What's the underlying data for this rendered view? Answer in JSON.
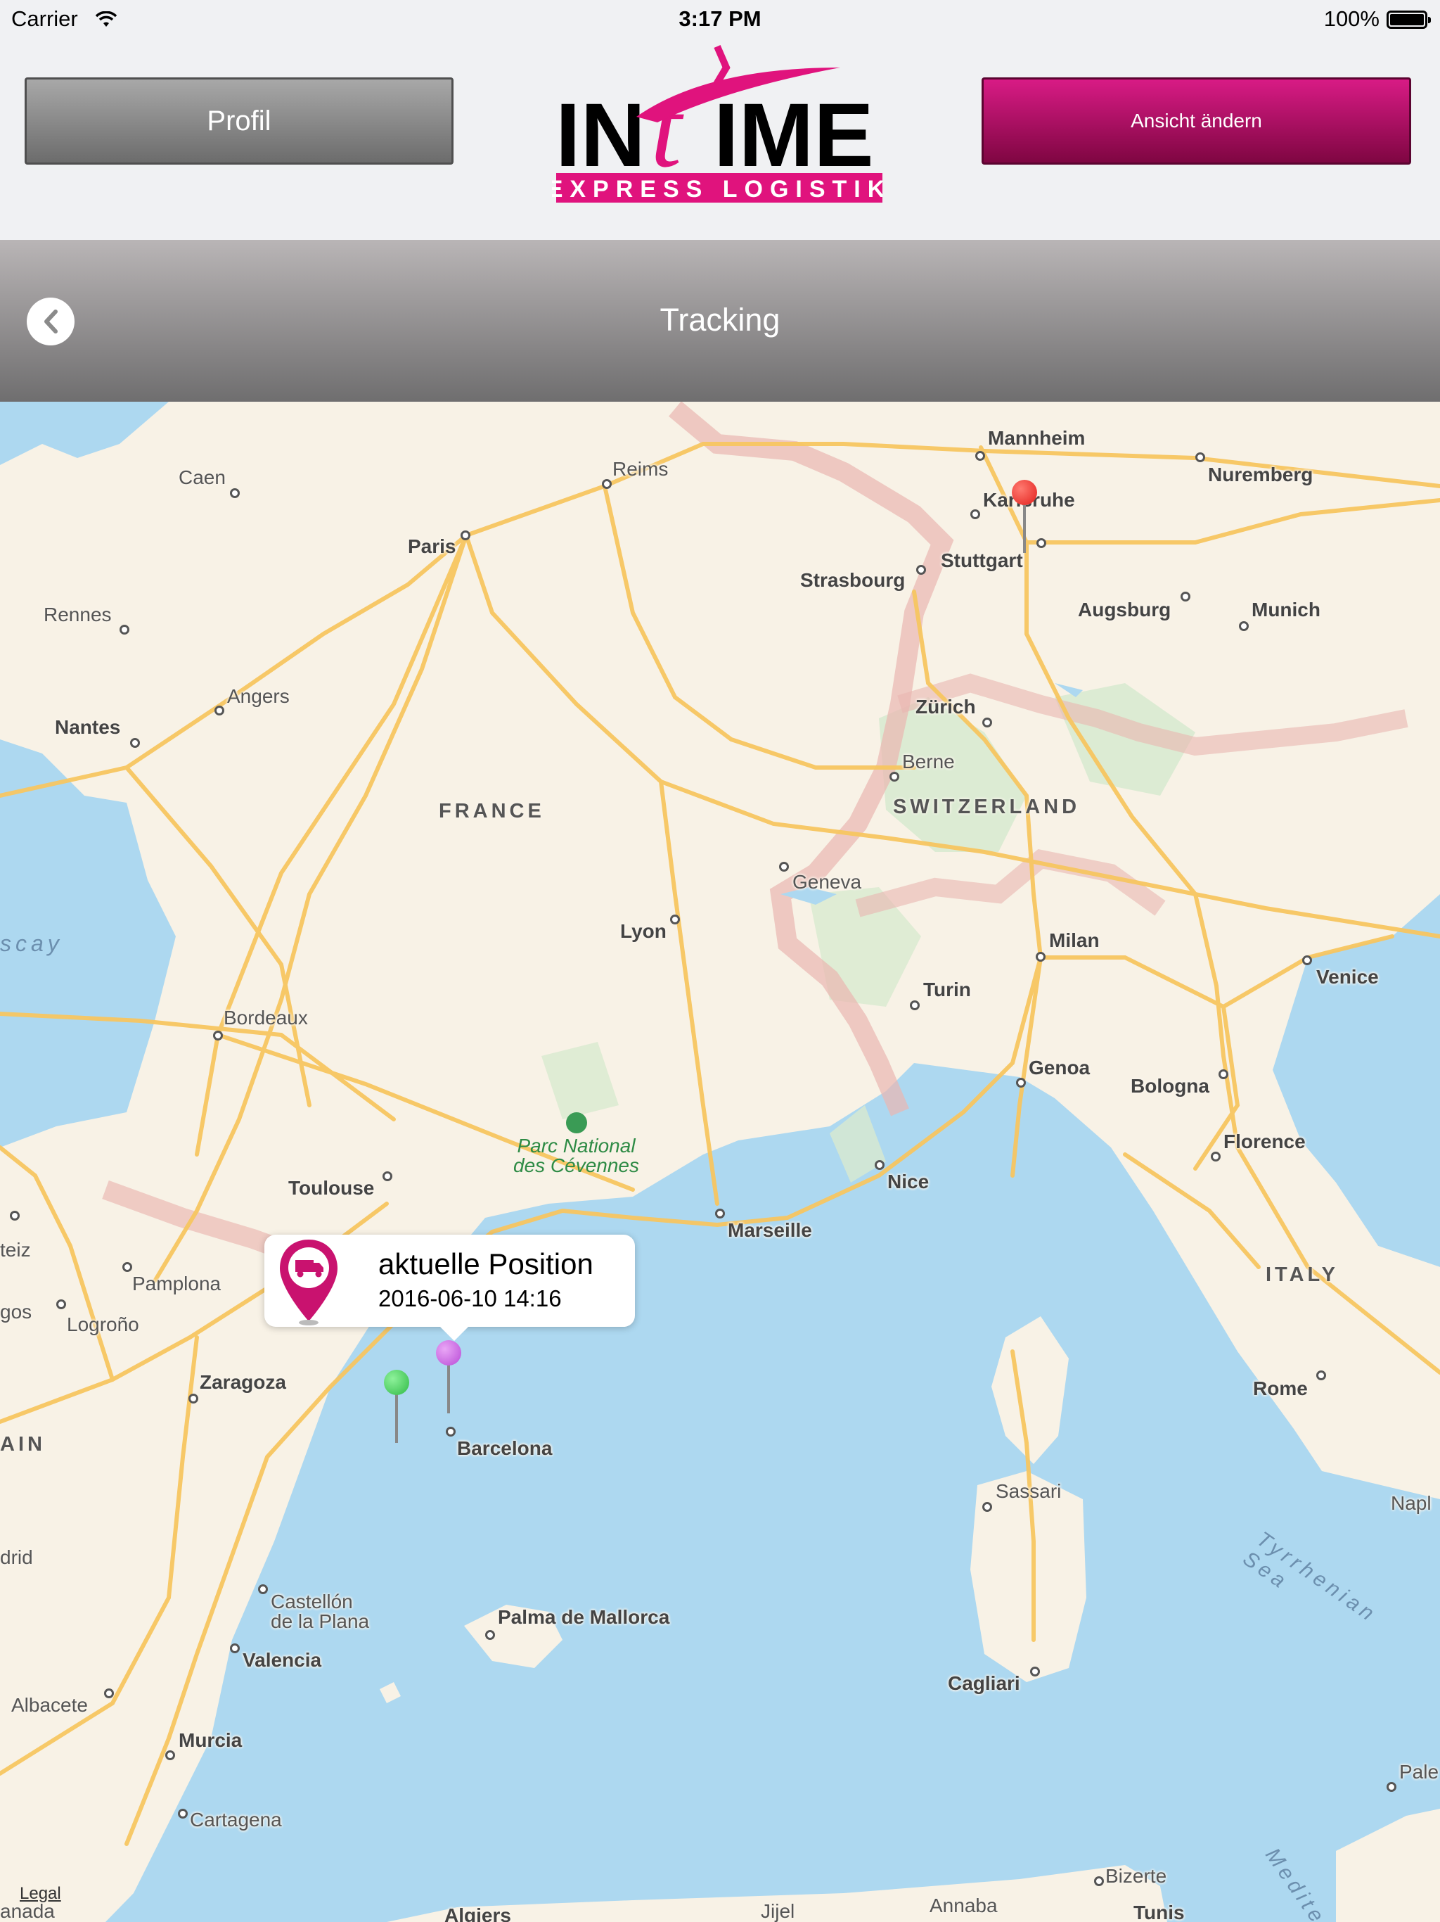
{
  "status_bar": {
    "carrier": "Carrier",
    "time": "3:17 PM",
    "battery": "100%"
  },
  "header": {
    "profile_label": "Profil",
    "view_label": "Ansicht ändern",
    "logo_word_left": "IN",
    "logo_word_t": "t",
    "logo_word_right": "IME",
    "logo_tagline": "EXPRESS LOGISTIK",
    "brand_color": "#e0137d"
  },
  "nav": {
    "title": "Tracking"
  },
  "map": {
    "countries": {
      "france": "FRANCE",
      "switzerland": "SWITZERLAND",
      "italy": "ITALY",
      "spain": "AIN"
    },
    "seas": {
      "biscay": "scay",
      "tyrrhenian": "Tyrrhenian Sea",
      "mediterranean": "Medite"
    },
    "park": [
      "Parc National",
      "des Cévennes"
    ],
    "cities": {
      "caen": "Caen",
      "reims": "Reims",
      "paris": "Paris",
      "rennes": "Rennes",
      "angers": "Angers",
      "nantes": "Nantes",
      "mannheim": "Mannheim",
      "karlsruhe": "Karlsruhe",
      "nuremberg": "Nuremberg",
      "stuttgart": "Stuttgart",
      "strasbourg": "Strasbourg",
      "augsburg": "Augsburg",
      "munich": "Munich",
      "zurich": "Zürich",
      "berne": "Berne",
      "geneva": "Geneva",
      "lyon": "Lyon",
      "milan": "Milan",
      "venice": "Venice",
      "turin": "Turin",
      "bordeaux": "Bordeaux",
      "genoa": "Genoa",
      "bologna": "Bologna",
      "florence": "Florence",
      "nice": "Nice",
      "toulouse": "Toulouse",
      "marseille": "Marseille",
      "pamplona": "Pamplona",
      "logrono": "Logroño",
      "zaragoza": "Zaragoza",
      "barcelona": "Barcelona",
      "rome": "Rome",
      "sassari": "Sassari",
      "napoli": "Napl",
      "castellon": "Castellón",
      "castellon2": "de la Plana",
      "palma": "Palma de Mallorca",
      "valencia": "Valencia",
      "cagliari": "Cagliari",
      "albacete": "Albacete",
      "murcia": "Murcia",
      "cartagena": "Cartagena",
      "bizerte": "Bizerte",
      "annaba": "Annaba",
      "tunis": "Tunis",
      "algiers": "Algiers",
      "jijel": "Jijel",
      "palermo": "Pale",
      "madrid": "drid",
      "vitoria": "teiz",
      "burgos": "gos",
      "granada": "anada"
    },
    "legal": "Legal",
    "pin_colors": {
      "red": "#f0302c",
      "green": "#35cc4c",
      "purple": "#c45ae0"
    },
    "callout": {
      "title": "aktuelle Position",
      "timestamp": "2016-06-10 14:16"
    }
  }
}
